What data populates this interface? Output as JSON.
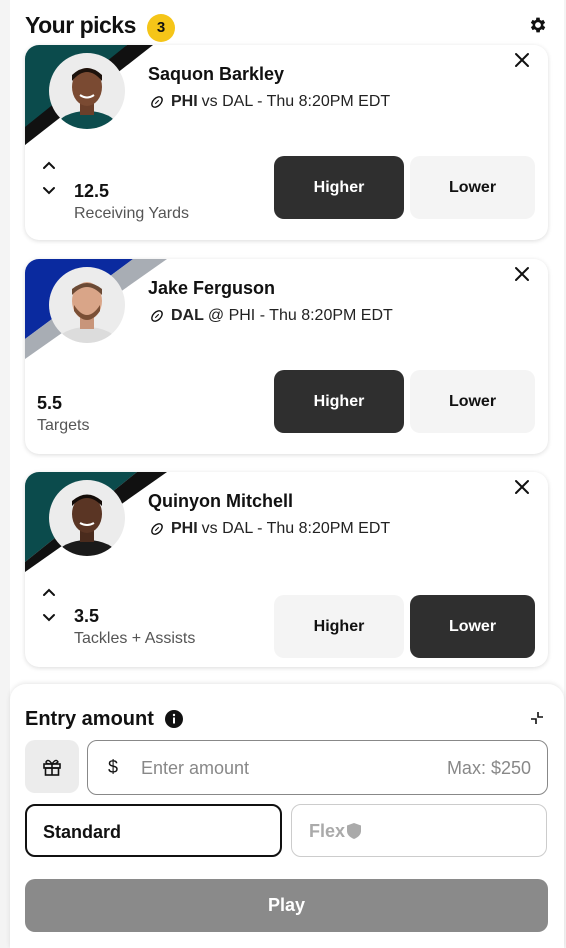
{
  "header": {
    "title": "Your picks",
    "count": "3",
    "settings_icon": "gear-icon"
  },
  "picks": [
    {
      "name": "Saquon Barkley",
      "team": "PHI",
      "matchup_rest": "vs DAL - Thu 8:20PM EDT",
      "value": "12.5",
      "stat": "Receiving Yards",
      "selected": "higher",
      "higher_label": "Higher",
      "lower_label": "Lower",
      "team_colors": [
        "#0b4b4c",
        "#111111"
      ]
    },
    {
      "name": "Jake Ferguson",
      "team": "DAL",
      "matchup_rest": "@ PHI - Thu 8:20PM EDT",
      "value": "5.5",
      "stat": "Targets",
      "selected": "higher",
      "higher_label": "Higher",
      "lower_label": "Lower",
      "team_colors": [
        "#0a2a9f",
        "#a8adb4"
      ]
    },
    {
      "name": "Quinyon Mitchell",
      "team": "PHI",
      "matchup_rest": "vs DAL - Thu 8:20PM EDT",
      "value": "3.5",
      "stat": "Tackles + Assists",
      "selected": "lower",
      "higher_label": "Higher",
      "lower_label": "Lower",
      "team_colors": [
        "#0b4b4c",
        "#111111"
      ]
    }
  ],
  "entry": {
    "title": "Entry amount",
    "currency": "$",
    "placeholder": "Enter amount",
    "max": "Max: $250",
    "standard_label": "Standard",
    "flex_label": "Flex",
    "play_label": "Play"
  },
  "colors": {
    "accent_badge": "#f5c518",
    "selected_button": "#2f2f2f",
    "play_disabled": "#8a8a8a"
  }
}
